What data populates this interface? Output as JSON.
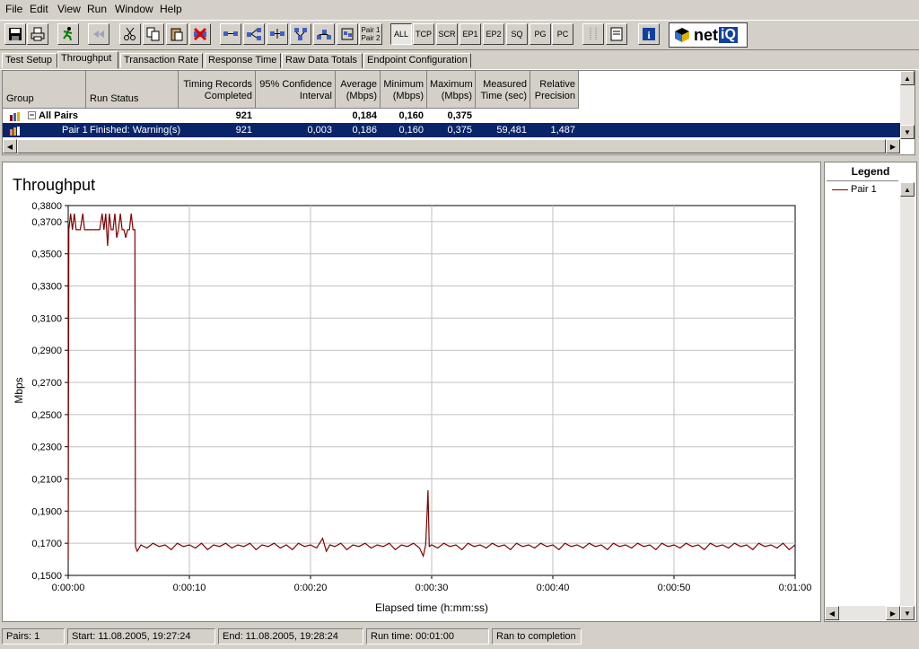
{
  "menu": [
    "File",
    "Edit",
    "View",
    "Run",
    "Window",
    "Help"
  ],
  "toolbar": {
    "pair_label_1": "Pair 1",
    "pair_label_2": "Pair 2",
    "filters": [
      "ALL",
      "TCP",
      "SCR",
      "EP1",
      "EP2",
      "SQ",
      "PG",
      "PC"
    ],
    "logo_text": "net",
    "logo_suffix": "iQ"
  },
  "tabs": [
    "Test Setup",
    "Throughput",
    "Transaction Rate",
    "Response Time",
    "Raw Data Totals",
    "Endpoint Configuration"
  ],
  "active_tab": "Throughput",
  "grid": {
    "headers": [
      {
        "line1": "",
        "line2": "Group"
      },
      {
        "line1": "",
        "line2": "Run Status"
      },
      {
        "line1": "Timing Records",
        "line2": "Completed"
      },
      {
        "line1": "95% Confidence",
        "line2": "Interval"
      },
      {
        "line1": "Average",
        "line2": "(Mbps)"
      },
      {
        "line1": "Minimum",
        "line2": "(Mbps)"
      },
      {
        "line1": "Maximum",
        "line2": "(Mbps)"
      },
      {
        "line1": "Measured",
        "line2": "Time (sec)"
      },
      {
        "line1": "Relative",
        "line2": "Precision"
      }
    ],
    "rows": [
      {
        "group": "All Pairs",
        "status": "",
        "records": "921",
        "ci": "",
        "avg": "0,184",
        "min": "0,160",
        "max": "0,375",
        "time": "",
        "precision": ""
      },
      {
        "group": "Pair 1",
        "status": "Finished: Warning(s)",
        "records": "921",
        "ci": "0,003",
        "avg": "0,186",
        "min": "0,160",
        "max": "0,375",
        "time": "59,481",
        "precision": "1,487"
      }
    ]
  },
  "chart_data": {
    "type": "line",
    "title": "Throughput",
    "xlabel": "Elapsed time (h:mm:ss)",
    "ylabel": "Mbps",
    "ylim": [
      0.15,
      0.38
    ],
    "xlim": [
      0,
      60
    ],
    "yticks": [
      "0,1500",
      "0,1700",
      "0,1900",
      "0,2100",
      "0,2300",
      "0,2500",
      "0,2700",
      "0,2900",
      "0,3100",
      "0,3300",
      "0,3500",
      "0,3700",
      "0,3800"
    ],
    "ytick_values": [
      0.15,
      0.17,
      0.19,
      0.21,
      0.23,
      0.25,
      0.27,
      0.29,
      0.31,
      0.33,
      0.35,
      0.37,
      0.38
    ],
    "xticks": [
      "0:00:00",
      "0:00:10",
      "0:00:20",
      "0:00:30",
      "0:00:40",
      "0:00:50",
      "0:01:00"
    ],
    "xtick_values": [
      0,
      10,
      20,
      30,
      40,
      50,
      60
    ],
    "grid": true,
    "series": [
      {
        "name": "Pair 1",
        "color": "#800000",
        "points": [
          [
            0.0,
            0.16
          ],
          [
            0.05,
            0.365
          ],
          [
            0.2,
            0.375
          ],
          [
            0.35,
            0.365
          ],
          [
            0.5,
            0.375
          ],
          [
            0.65,
            0.365
          ],
          [
            0.8,
            0.365
          ],
          [
            1.0,
            0.365
          ],
          [
            1.2,
            0.375
          ],
          [
            1.35,
            0.365
          ],
          [
            1.6,
            0.365
          ],
          [
            1.8,
            0.365
          ],
          [
            2.0,
            0.365
          ],
          [
            2.2,
            0.365
          ],
          [
            2.4,
            0.365
          ],
          [
            2.6,
            0.365
          ],
          [
            2.8,
            0.375
          ],
          [
            2.95,
            0.365
          ],
          [
            3.1,
            0.375
          ],
          [
            3.25,
            0.355
          ],
          [
            3.4,
            0.375
          ],
          [
            3.55,
            0.365
          ],
          [
            3.7,
            0.365
          ],
          [
            3.85,
            0.375
          ],
          [
            4.0,
            0.36
          ],
          [
            4.15,
            0.365
          ],
          [
            4.3,
            0.375
          ],
          [
            4.45,
            0.365
          ],
          [
            4.6,
            0.365
          ],
          [
            4.75,
            0.36
          ],
          [
            4.9,
            0.365
          ],
          [
            5.05,
            0.365
          ],
          [
            5.2,
            0.375
          ],
          [
            5.35,
            0.365
          ],
          [
            5.5,
            0.365
          ],
          [
            5.55,
            0.168
          ],
          [
            5.7,
            0.165
          ],
          [
            6.0,
            0.169
          ],
          [
            6.5,
            0.167
          ],
          [
            7.0,
            0.17
          ],
          [
            7.5,
            0.168
          ],
          [
            8.0,
            0.169
          ],
          [
            8.5,
            0.166
          ],
          [
            9.0,
            0.17
          ],
          [
            9.5,
            0.168
          ],
          [
            10.0,
            0.169
          ],
          [
            10.5,
            0.167
          ],
          [
            11.0,
            0.17
          ],
          [
            11.5,
            0.166
          ],
          [
            12.0,
            0.169
          ],
          [
            12.5,
            0.168
          ],
          [
            13.0,
            0.17
          ],
          [
            13.5,
            0.167
          ],
          [
            14.0,
            0.169
          ],
          [
            14.5,
            0.168
          ],
          [
            15.0,
            0.17
          ],
          [
            15.5,
            0.166
          ],
          [
            16.0,
            0.169
          ],
          [
            16.5,
            0.168
          ],
          [
            17.0,
            0.17
          ],
          [
            17.5,
            0.167
          ],
          [
            18.0,
            0.169
          ],
          [
            18.5,
            0.166
          ],
          [
            19.0,
            0.17
          ],
          [
            19.5,
            0.168
          ],
          [
            20.0,
            0.169
          ],
          [
            20.5,
            0.167
          ],
          [
            21.0,
            0.173
          ],
          [
            21.3,
            0.165
          ],
          [
            21.6,
            0.169
          ],
          [
            22.0,
            0.168
          ],
          [
            22.5,
            0.17
          ],
          [
            23.0,
            0.166
          ],
          [
            23.5,
            0.169
          ],
          [
            24.0,
            0.168
          ],
          [
            24.5,
            0.17
          ],
          [
            25.0,
            0.167
          ],
          [
            25.5,
            0.169
          ],
          [
            26.0,
            0.168
          ],
          [
            26.5,
            0.17
          ],
          [
            27.0,
            0.166
          ],
          [
            27.5,
            0.169
          ],
          [
            28.0,
            0.168
          ],
          [
            28.5,
            0.17
          ],
          [
            29.0,
            0.167
          ],
          [
            29.3,
            0.162
          ],
          [
            29.5,
            0.169
          ],
          [
            29.6,
            0.185
          ],
          [
            29.7,
            0.203
          ],
          [
            29.8,
            0.168
          ],
          [
            30.0,
            0.169
          ],
          [
            30.5,
            0.167
          ],
          [
            31.0,
            0.17
          ],
          [
            31.5,
            0.168
          ],
          [
            32.0,
            0.169
          ],
          [
            32.5,
            0.166
          ],
          [
            33.0,
            0.17
          ],
          [
            33.5,
            0.168
          ],
          [
            34.0,
            0.169
          ],
          [
            34.5,
            0.167
          ],
          [
            35.0,
            0.17
          ],
          [
            35.5,
            0.168
          ],
          [
            36.0,
            0.169
          ],
          [
            36.5,
            0.166
          ],
          [
            37.0,
            0.17
          ],
          [
            37.5,
            0.168
          ],
          [
            38.0,
            0.169
          ],
          [
            38.5,
            0.167
          ],
          [
            39.0,
            0.17
          ],
          [
            39.5,
            0.168
          ],
          [
            40.0,
            0.169
          ],
          [
            40.5,
            0.166
          ],
          [
            41.0,
            0.17
          ],
          [
            41.5,
            0.168
          ],
          [
            42.0,
            0.169
          ],
          [
            42.5,
            0.167
          ],
          [
            43.0,
            0.17
          ],
          [
            43.5,
            0.168
          ],
          [
            44.0,
            0.169
          ],
          [
            44.5,
            0.166
          ],
          [
            45.0,
            0.17
          ],
          [
            45.5,
            0.168
          ],
          [
            46.0,
            0.169
          ],
          [
            46.5,
            0.167
          ],
          [
            47.0,
            0.17
          ],
          [
            47.5,
            0.168
          ],
          [
            48.0,
            0.169
          ],
          [
            48.5,
            0.166
          ],
          [
            49.0,
            0.17
          ],
          [
            49.5,
            0.168
          ],
          [
            50.0,
            0.169
          ],
          [
            50.5,
            0.167
          ],
          [
            51.0,
            0.17
          ],
          [
            51.5,
            0.168
          ],
          [
            52.0,
            0.169
          ],
          [
            52.5,
            0.166
          ],
          [
            53.0,
            0.17
          ],
          [
            53.5,
            0.168
          ],
          [
            54.0,
            0.169
          ],
          [
            54.5,
            0.167
          ],
          [
            55.0,
            0.17
          ],
          [
            55.5,
            0.168
          ],
          [
            56.0,
            0.169
          ],
          [
            56.5,
            0.166
          ],
          [
            57.0,
            0.17
          ],
          [
            57.5,
            0.168
          ],
          [
            58.0,
            0.169
          ],
          [
            58.5,
            0.167
          ],
          [
            59.0,
            0.17
          ],
          [
            59.5,
            0.166
          ],
          [
            60.0,
            0.169
          ]
        ]
      }
    ]
  },
  "legend": {
    "title": "Legend",
    "items": [
      "Pair 1"
    ]
  },
  "status": {
    "pairs": "Pairs: 1",
    "start": "Start: 11.08.2005, 19:27:24",
    "end": "End: 11.08.2005, 19:28:24",
    "runtime": "Run time: 00:01:00",
    "state": "Ran to completion"
  }
}
